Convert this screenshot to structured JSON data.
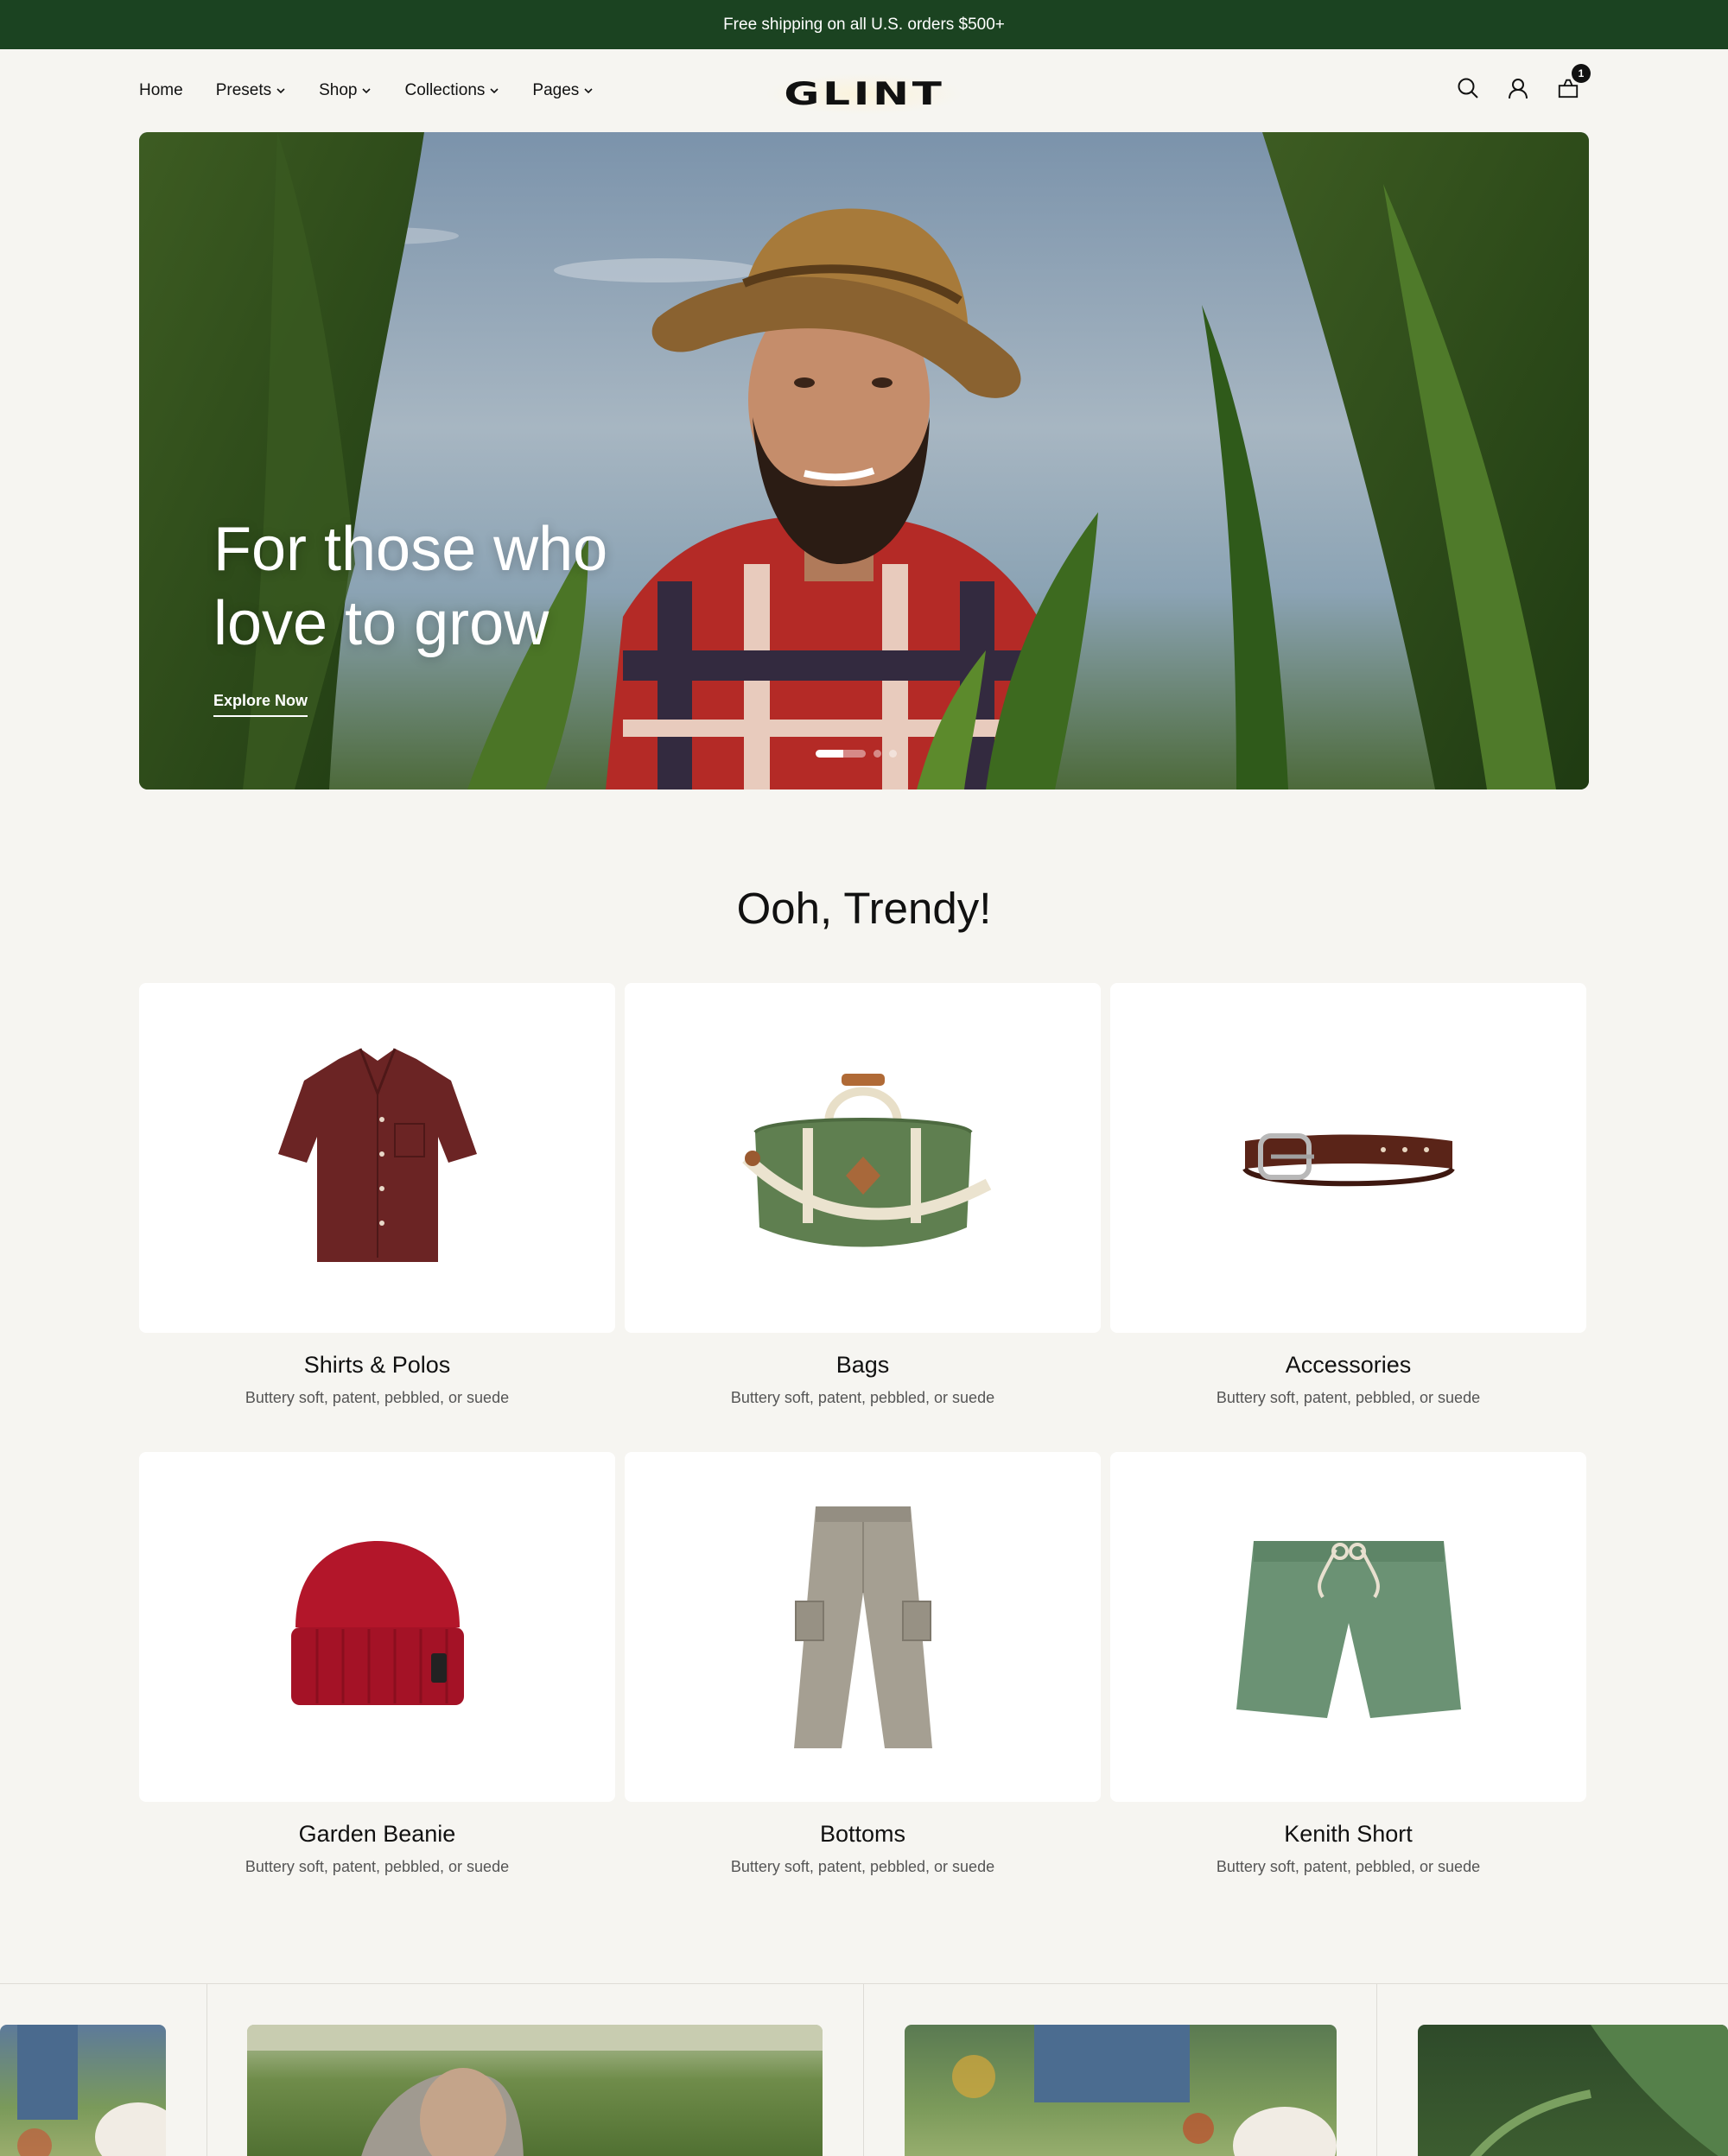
{
  "announcement": "Free shipping on all U.S. orders $500+",
  "nav": {
    "links": [
      "Home",
      "Presets",
      "Shop",
      "Collections",
      "Pages"
    ],
    "logo": "GLINT",
    "cart_count": "1"
  },
  "hero": {
    "title_line1": "For those who",
    "title_line2": "love to grow",
    "cta": "Explore Now",
    "slides": 4,
    "active_slide": 1
  },
  "section": {
    "title": "Ooh, Trendy!",
    "cards": [
      {
        "title": "Shirts & Polos",
        "subtitle": "Buttery soft, patent, pebbled, or suede"
      },
      {
        "title": "Bags",
        "subtitle": "Buttery soft, patent, pebbled, or suede"
      },
      {
        "title": "Accessories",
        "subtitle": "Buttery soft, patent, pebbled, or suede"
      },
      {
        "title": "Garden Beanie",
        "subtitle": "Buttery soft, patent, pebbled, or suede"
      },
      {
        "title": "Bottoms",
        "subtitle": "Buttery soft, patent, pebbled, or suede"
      },
      {
        "title": "Kenith Short",
        "subtitle": "Buttery soft, patent, pebbled, or suede"
      }
    ]
  },
  "colors": {
    "announcement_bg": "#1b4321",
    "page_bg": "#f6f5f1"
  }
}
